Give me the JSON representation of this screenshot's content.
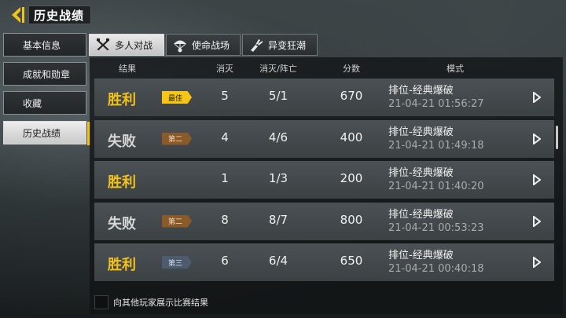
{
  "header": {
    "title": "历史战绩"
  },
  "sidebar": {
    "items": [
      {
        "label": "基本信息"
      },
      {
        "label": "成就和勋章"
      },
      {
        "label": "收藏"
      },
      {
        "label": "历史战绩"
      }
    ]
  },
  "tabs": [
    {
      "label": "多人对战",
      "icon": "crossed-guns-icon"
    },
    {
      "label": "使命战场",
      "icon": "parachute-icon"
    },
    {
      "label": "异变狂潮",
      "icon": "claw-arm-icon"
    }
  ],
  "columns": {
    "result": "结果",
    "kills": "消灭",
    "kd": "消灭/阵亡",
    "score": "分数",
    "mode": "模式"
  },
  "matches": [
    {
      "result": "胜利",
      "badge": "最佳",
      "kills": "5",
      "kd": "5/1",
      "score": "670",
      "mode": "排位-经典爆破",
      "time": "21-04-21 01:56:27"
    },
    {
      "result": "失败",
      "badge": "第二",
      "kills": "4",
      "kd": "4/6",
      "score": "400",
      "mode": "排位-经典爆破",
      "time": "21-04-21 01:49:18"
    },
    {
      "result": "胜利",
      "badge": "",
      "kills": "1",
      "kd": "1/3",
      "score": "200",
      "mode": "排位-经典爆破",
      "time": "21-04-21 01:40:20"
    },
    {
      "result": "失败",
      "badge": "第二",
      "kills": "8",
      "kd": "8/7",
      "score": "800",
      "mode": "排位-经典爆破",
      "time": "21-04-21 00:53:23"
    },
    {
      "result": "胜利",
      "badge": "第三",
      "kills": "6",
      "kd": "6/4",
      "score": "650",
      "mode": "排位-经典爆破",
      "time": "21-04-21 00:40:18"
    }
  ],
  "footer": {
    "checkbox_label": "向其他玩家展示比赛结果"
  },
  "colors": {
    "accent": "#f2c318",
    "win": "#f3c21a",
    "lose": "#d6d6d6"
  }
}
